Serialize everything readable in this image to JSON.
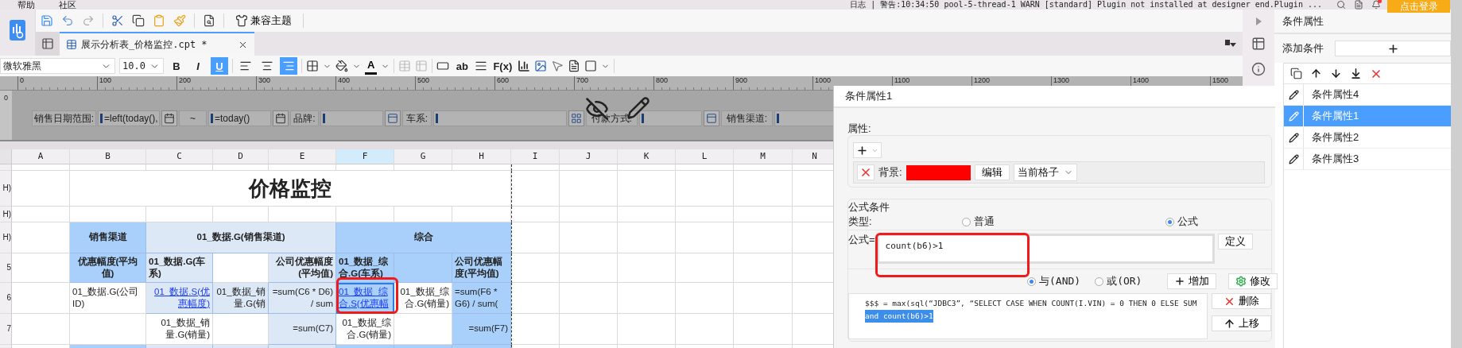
{
  "menu": [
    {
      "label": "帮助"
    },
    {
      "label": "社区"
    }
  ],
  "log": "日志 | 警告:10:34:50 pool-5-thread-1 WARN [standard] Plugin not installed at designer end.Plugin ...",
  "notifications": {
    "unread": true
  },
  "login_button": "点击登录",
  "toolbar": {
    "theme_button": "兼容主题"
  },
  "tabs": [
    {
      "label": "展示分析表_价格监控.cpt *",
      "selected": true
    }
  ],
  "format": {
    "font": "微软雅黑",
    "size": "10.0",
    "styles": [
      {
        "label": "B",
        "on": false
      },
      {
        "label": "I",
        "on": false
      },
      {
        "label": "U",
        "on": true
      }
    ],
    "aligns": [
      {
        "selected": false
      },
      {
        "selected": false
      },
      {
        "selected": true
      }
    ],
    "font_color_label": "A",
    "text_label": "ab",
    "formula_label": "F(x)"
  },
  "ruler": [
    "0",
    "100",
    "200",
    "300",
    "400",
    "500",
    "600",
    "700",
    "800",
    "900",
    "1000",
    "1100",
    "1200",
    "1300",
    "1400",
    "1500"
  ],
  "row_ruler": "0",
  "parameters": [
    {
      "kind": "label",
      "text": "销售日期范围:"
    },
    {
      "kind": "field",
      "value": "=left(today(),"
    },
    {
      "kind": "date_button"
    },
    {
      "kind": "label",
      "text": "~"
    },
    {
      "kind": "field",
      "value": "=today()"
    },
    {
      "kind": "date_button"
    },
    {
      "kind": "label",
      "text": "品牌:"
    },
    {
      "kind": "field"
    },
    {
      "kind": "dropdown_button"
    },
    {
      "kind": "label",
      "text": "车系:"
    },
    {
      "kind": "field"
    },
    {
      "kind": "layout_button"
    },
    {
      "kind": "label",
      "text": "付款方式:"
    },
    {
      "kind": "field"
    },
    {
      "kind": "dropdown_button"
    },
    {
      "kind": "label",
      "text": "销售渠道:"
    },
    {
      "kind": "field"
    }
  ],
  "columns": [
    {
      "label": "A",
      "selected": false
    },
    {
      "label": "B",
      "selected": false
    },
    {
      "label": "C",
      "selected": false
    },
    {
      "label": "D",
      "selected": false
    },
    {
      "label": "E",
      "selected": false
    },
    {
      "label": "F",
      "selected": true
    },
    {
      "label": "G",
      "selected": false
    },
    {
      "label": "H",
      "selected": false
    },
    {
      "label": "I",
      "selected": false
    },
    {
      "label": "J",
      "selected": false
    },
    {
      "label": "K",
      "selected": false
    },
    {
      "label": "L",
      "selected": false
    },
    {
      "label": "M",
      "selected": false
    },
    {
      "label": "N",
      "selected": false
    }
  ],
  "rows": [
    {
      "cells": [
        {
          "kind": "blank",
          "selected": false
        }
      ]
    },
    {
      "header": "H)",
      "cells": [
        {
          "kind": "blank",
          "selected": false
        },
        {
          "kind": "title",
          "text": "价格监控",
          "selected": false
        }
      ]
    },
    {
      "header": "H)",
      "cells": [
        {
          "kind": "blank",
          "selected": false
        }
      ]
    },
    {
      "header": "H)",
      "cells": [
        {
          "kind": "blank",
          "selected": false
        },
        {
          "kind": "header",
          "text": "销售渠道",
          "selected": false
        },
        {
          "kind": "header",
          "text": "01_数据.G(销售渠道)",
          "selected": false
        },
        {
          "kind": "header",
          "text": "综合",
          "selected": false
        }
      ]
    },
    {
      "header": "5",
      "cells": [
        {
          "kind": "blank",
          "selected": false
        },
        {
          "kind": "header",
          "text": "优惠幅度(平均值)",
          "selected": false
        },
        {
          "kind": "header",
          "text": "01_数据.G(车系)",
          "selected": false
        },
        {
          "kind": "blank",
          "selected": false
        },
        {
          "kind": "header",
          "text": "公司优惠幅度(平均值)",
          "selected": false
        },
        {
          "kind": "header",
          "text": "01_数据_综合.G(车系)",
          "selected": false
        },
        {
          "kind": "blank",
          "selected": false
        },
        {
          "kind": "header",
          "text": "公司优惠幅度(平均值)",
          "selected": false
        }
      ]
    },
    {
      "header": "6",
      "cells": [
        {
          "kind": "blank",
          "selected": false
        },
        {
          "kind": "data",
          "text": "01_数据.G(公司ID)",
          "selected": false
        },
        {
          "kind": "link",
          "text": "01_数据.S(优惠幅度)",
          "selected": false
        },
        {
          "kind": "data",
          "text": "01_数据_销量.G(销",
          "selected": false
        },
        {
          "kind": "data",
          "text": "=sum(C6 * D6) / sum",
          "selected": false
        },
        {
          "kind": "link",
          "text": "01_数据_综合.S(优惠幅",
          "selected": true
        },
        {
          "kind": "data",
          "text": "01_数据_综合.G(销量)",
          "selected": false
        },
        {
          "kind": "data",
          "text": "=sum(F6 * G6) / sum(",
          "selected": false
        }
      ]
    },
    {
      "header": "7",
      "cells": [
        {
          "kind": "blank",
          "selected": false
        },
        {
          "kind": "blank",
          "selected": false
        },
        {
          "kind": "data",
          "text": "01_数据_销量.G(销量)",
          "selected": false
        },
        {
          "kind": "blank",
          "selected": false
        },
        {
          "kind": "data",
          "text": "=sum(C7)",
          "selected": false
        },
        {
          "kind": "data",
          "text": "01_数据_综合.G(销量)",
          "selected": false
        },
        {
          "kind": "blank",
          "selected": false
        },
        {
          "kind": "data",
          "text": "=sum(F7)",
          "selected": false
        }
      ]
    },
    {
      "cells": [
        {
          "kind": "blank",
          "selected": false
        },
        {
          "kind": "blank",
          "selected": false
        },
        {
          "kind": "blank",
          "selected": false
        },
        {
          "kind": "blank",
          "selected": false
        },
        {
          "kind": "blank",
          "selected": false
        },
        {
          "kind": "blank",
          "selected": false
        },
        {
          "kind": "blank",
          "selected": false
        },
        {
          "kind": "blank",
          "selected": false
        }
      ]
    }
  ],
  "dialog": {
    "title": "条件属性1",
    "attributes_label": "属性:",
    "background": {
      "label": "背景:",
      "color": "#ff0000",
      "edit_button": "编辑",
      "scope": "当前格子"
    },
    "formula_section": {
      "title": "公式条件",
      "type_label": "类型:",
      "types": [
        {
          "label": "普通",
          "selected": false
        },
        {
          "label": "公式",
          "selected": true
        }
      ],
      "formula_label": "公式=",
      "formula": "count(b6)>1",
      "define_button": "定义",
      "joins": [
        {
          "label": "与(AND)",
          "selected": true
        },
        {
          "label": "或(OR)",
          "selected": false
        }
      ],
      "add_button": "增加",
      "modify_button": "修改",
      "conditions": [
        {
          "text": "$$$ = max(sql(“JDBC3”, “SELECT CASE WHEN COUNT(I.VIN) = 0 THEN 0 ELSE SUM",
          "selected": false
        },
        {
          "text": "and count(b6)>1",
          "selected": true
        }
      ],
      "delete_button": "删除",
      "up_button": "上移"
    }
  },
  "sidebar": {
    "title": "条件属性",
    "add_label": "添加条件",
    "items": [
      {
        "label": "条件属性4",
        "selected": false
      },
      {
        "label": "条件属性1",
        "selected": true
      },
      {
        "label": "条件属性2",
        "selected": false
      },
      {
        "label": "条件属性3",
        "selected": false
      }
    ]
  }
}
